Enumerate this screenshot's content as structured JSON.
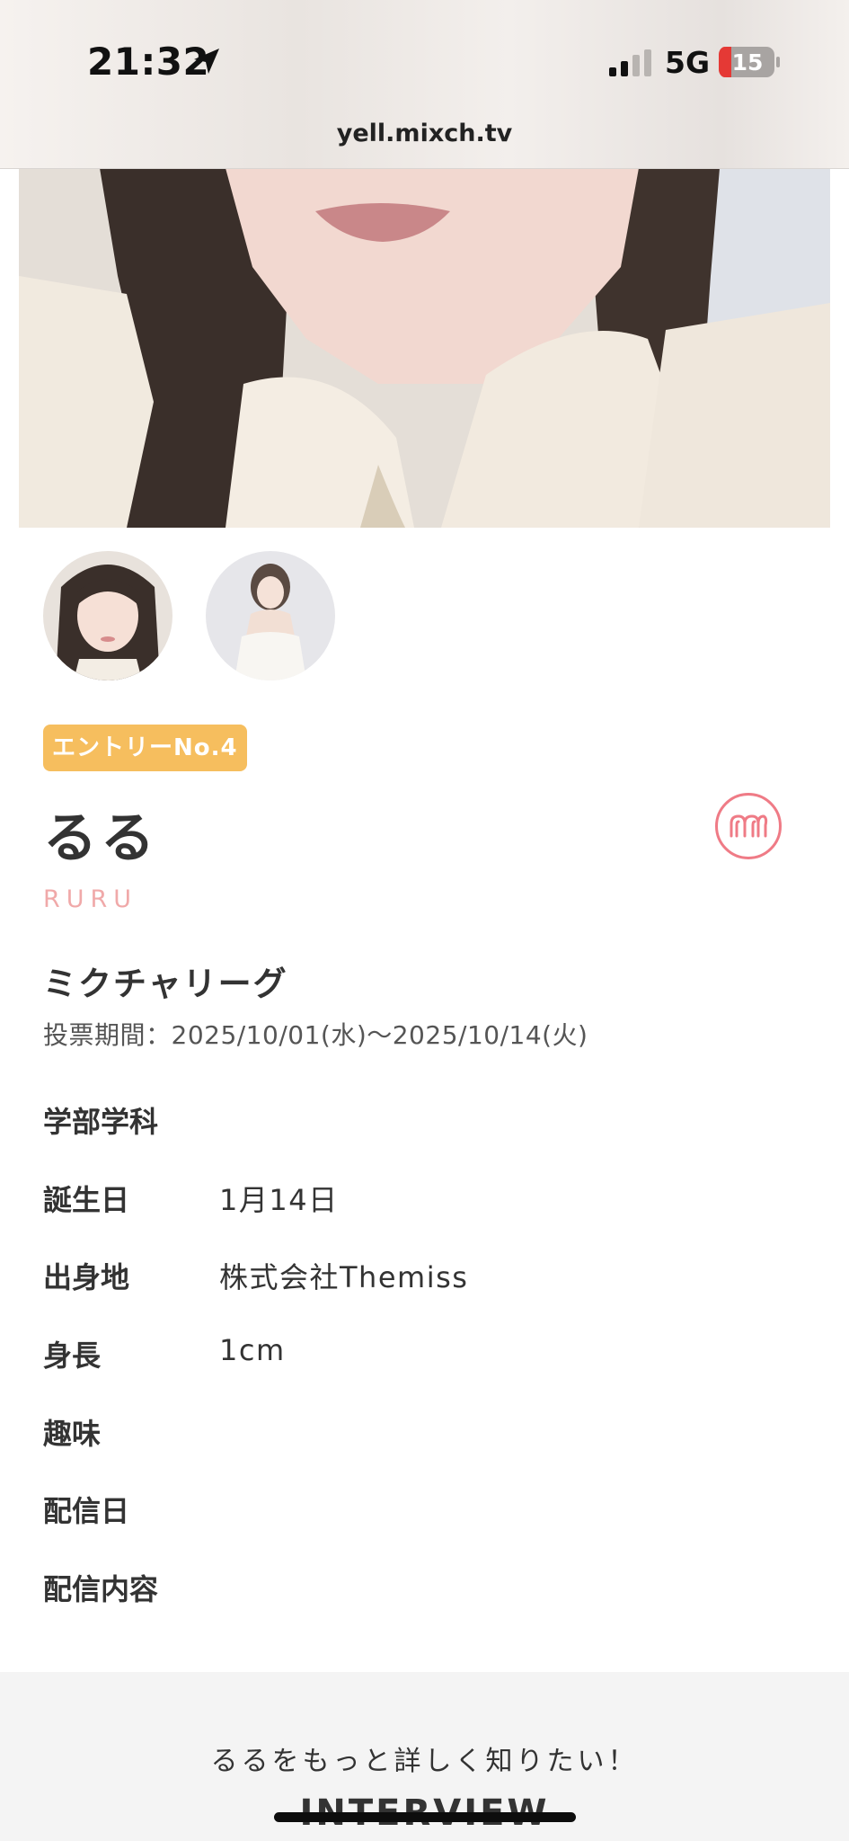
{
  "status_bar": {
    "time": "21:32",
    "network": "5G",
    "battery": "15",
    "battery_level": 0.15,
    "url": "yell.mixch.tv"
  },
  "profile": {
    "entry_badge": "エントリーNo.4",
    "name": "るる",
    "name_romaji": "RURU",
    "league": "ミクチャリーグ",
    "vote_period_label": "投票期間：",
    "vote_period": "2025/10/01(水)〜2025/10/14(火)",
    "accent_color": "#f6be5e",
    "brand_color": "#ef7b86"
  },
  "details": [
    {
      "label": "学部学科",
      "value": ""
    },
    {
      "label": "誕生日",
      "value": "1月14日"
    },
    {
      "label": "出身地",
      "value": "株式会社Themiss"
    },
    {
      "label": "身長",
      "value": "1cm"
    },
    {
      "label": "趣味",
      "value": ""
    },
    {
      "label": "配信日",
      "value": ""
    },
    {
      "label": "配信内容",
      "value": ""
    }
  ],
  "footer": {
    "teaser": "るるをもっと詳しく知りたい！",
    "heading": "INTERVIEW"
  },
  "icons": [
    "location-arrow-icon",
    "signal-icon",
    "battery-icon",
    "mixch-logo-icon"
  ]
}
